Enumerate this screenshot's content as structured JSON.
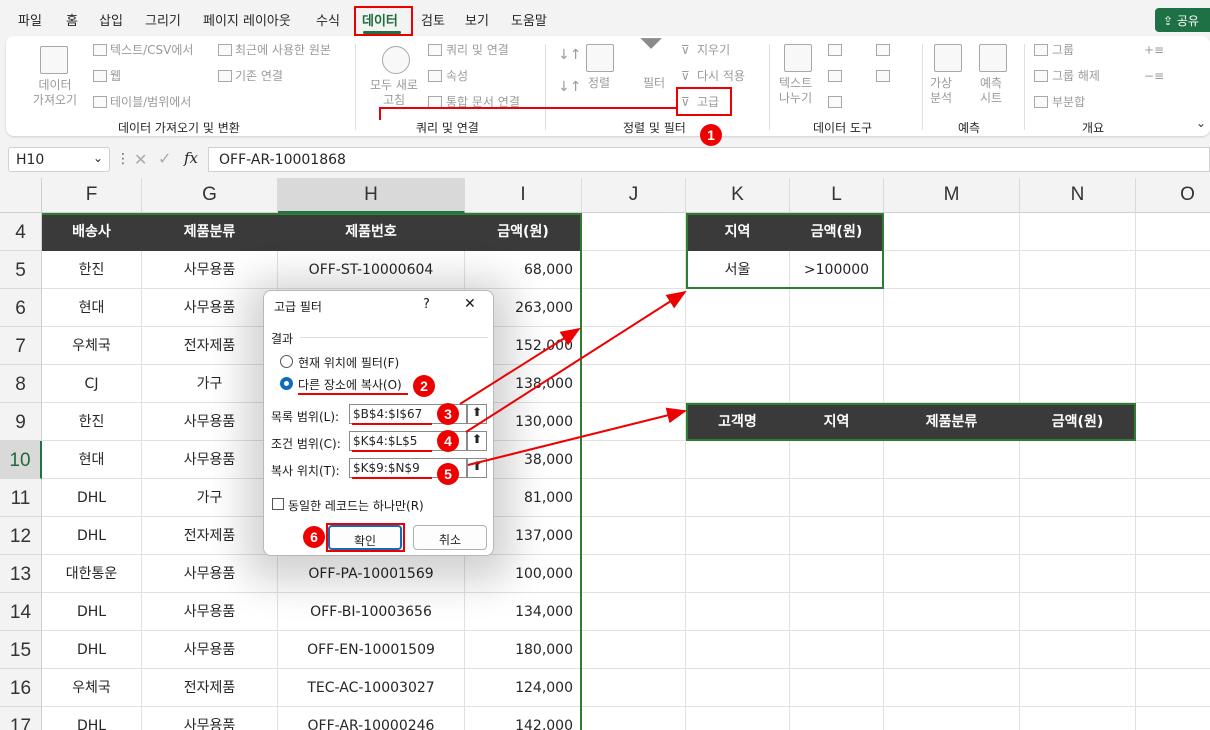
{
  "menu": {
    "tabs": [
      "파일",
      "홈",
      "삽입",
      "그리기",
      "페이지 레이아웃",
      "수식",
      "데이터",
      "검토",
      "보기",
      "도움말"
    ],
    "share": "공유"
  },
  "ribbon": {
    "get_data": {
      "big": "데이터\n가져오기",
      "text_csv": "텍스트/CSV에서",
      "web": "웹",
      "table_range": "테이블/범위에서",
      "recent": "최근에 사용한 원본",
      "existing": "기존 연결",
      "label": "데이터 가져오기 및 변환"
    },
    "queries": {
      "refresh_all": "모두 새로\n고침",
      "queries_conn": "쿼리 및 연결",
      "properties": "속성",
      "edit_links": "통합 문서 연결",
      "label": "쿼리 및 연결"
    },
    "sort_filter": {
      "sort": "정렬",
      "filter": "필터",
      "clear": "지우기",
      "reapply": "다시 적용",
      "advanced": "고급",
      "label": "정렬 및 필터"
    },
    "data_tools": {
      "text_to_cols": "텍스트\n나누기",
      "label": "데이터 도구"
    },
    "forecast": {
      "whatif": "가상\n분석",
      "sheet": "예측\n시트",
      "label": "예측"
    },
    "outline": {
      "group": "그룹",
      "ungroup": "그룹 해제",
      "subtotal": "부분합",
      "label": "개요"
    }
  },
  "formula_bar": {
    "name_box": "H10",
    "fx": "fx",
    "value": "OFF-AR-10001868"
  },
  "columns": [
    "F",
    "G",
    "H",
    "I",
    "J",
    "K",
    "L",
    "M",
    "N",
    "O"
  ],
  "rows": [
    "4",
    "5",
    "6",
    "7",
    "8",
    "9",
    "10",
    "11",
    "12",
    "13",
    "14",
    "15",
    "16",
    "17"
  ],
  "table": {
    "headers": [
      "배송사",
      "제품분류",
      "제품번호",
      "금액(원)"
    ],
    "rows": [
      [
        "한진",
        "사무용품",
        "OFF-ST-10000604",
        "68,000"
      ],
      [
        "현대",
        "사무용품",
        "",
        "263,000"
      ],
      [
        "우체국",
        "전자제품",
        "",
        "152,000"
      ],
      [
        "CJ",
        "가구",
        "",
        "138,000"
      ],
      [
        "한진",
        "사무용품",
        "",
        "130,000"
      ],
      [
        "현대",
        "사무용품",
        "",
        "38,000"
      ],
      [
        "DHL",
        "가구",
        "",
        "81,000"
      ],
      [
        "DHL",
        "전자제품",
        "",
        "137,000"
      ],
      [
        "대한통운",
        "사무용품",
        "OFF-PA-10001569",
        "100,000"
      ],
      [
        "DHL",
        "사무용품",
        "OFF-BI-10003656",
        "134,000"
      ],
      [
        "DHL",
        "사무용품",
        "OFF-EN-10001509",
        "180,000"
      ],
      [
        "우체국",
        "전자제품",
        "TEC-AC-10003027",
        "124,000"
      ],
      [
        "DHL",
        "사무용품",
        "OFF-AR-10000246",
        "142,000"
      ]
    ]
  },
  "criteria": {
    "headers": [
      "지역",
      "금액(원)"
    ],
    "values": [
      "서울",
      ">100000"
    ]
  },
  "output": {
    "headers": [
      "고객명",
      "지역",
      "제품분류",
      "금액(원)"
    ]
  },
  "dialog": {
    "title": "고급 필터",
    "help": "?",
    "close": "✕",
    "result_label": "결과",
    "opt_inplace": "현재 위치에 필터(F)",
    "opt_copy": "다른 장소에 복사(O)",
    "list_label": "목록 범위(L):",
    "list_value": "$B$4:$I$67",
    "criteria_label": "조건 범위(C):",
    "criteria_value": "$K$4:$L$5",
    "copy_label": "복사 위치(T):",
    "copy_value": "$K$9:$N$9",
    "unique_label": "동일한 레코드는 하나만(R)",
    "ok": "확인",
    "cancel": "취소"
  },
  "badges": [
    "1",
    "2",
    "3",
    "4",
    "5",
    "6"
  ],
  "colors": {
    "accent": "#1e7145",
    "annotation": "#e00000",
    "header_fill": "#3a3a3a"
  }
}
